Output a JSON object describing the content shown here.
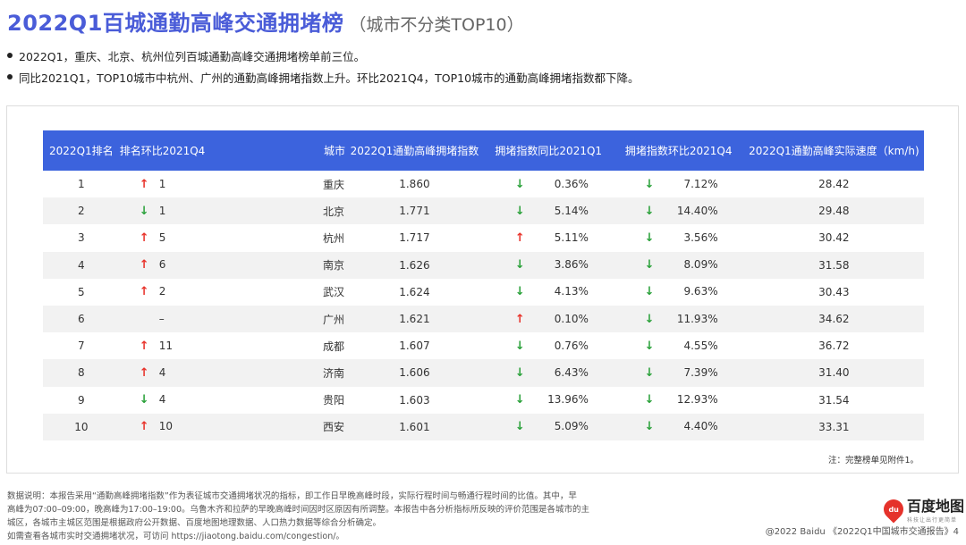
{
  "header": {
    "title": "2022Q1百城通勤高峰交通拥堵榜",
    "subtitle": "（城市不分类TOP10）"
  },
  "bullets": [
    "2022Q1，重庆、北京、杭州位列百城通勤高峰交通拥堵榜单前三位。",
    "同比2021Q1，TOP10城市中杭州、广州的通勤高峰拥堵指数上升。环比2021Q4，TOP10城市的通勤高峰拥堵指数都下降。"
  ],
  "table": {
    "columns": [
      "2022Q1排名",
      "排名环比2021Q4",
      "城市",
      "2022Q1通勤高峰拥堵指数",
      "拥堵指数同比2021Q1",
      "拥堵指数环比2021Q4",
      "2022Q1通勤高峰实际速度（km/h)"
    ],
    "rows": [
      {
        "rank": "1",
        "chg_dir": "up",
        "chg_arrow": "↑",
        "chg": "1",
        "city": "重庆",
        "index": "1.860",
        "yoy_dir": "down",
        "yoy_arrow": "↓",
        "yoy": "0.36%",
        "qoq_dir": "down",
        "qoq_arrow": "↓",
        "qoq": "7.12%",
        "speed": "28.42"
      },
      {
        "rank": "2",
        "chg_dir": "down",
        "chg_arrow": "↓",
        "chg": "1",
        "city": "北京",
        "index": "1.771",
        "yoy_dir": "down",
        "yoy_arrow": "↓",
        "yoy": "5.14%",
        "qoq_dir": "down",
        "qoq_arrow": "↓",
        "qoq": "14.40%",
        "speed": "29.48"
      },
      {
        "rank": "3",
        "chg_dir": "up",
        "chg_arrow": "↑",
        "chg": "5",
        "city": "杭州",
        "index": "1.717",
        "yoy_dir": "up",
        "yoy_arrow": "↑",
        "yoy": "5.11%",
        "qoq_dir": "down",
        "qoq_arrow": "↓",
        "qoq": "3.56%",
        "speed": "30.42"
      },
      {
        "rank": "4",
        "chg_dir": "up",
        "chg_arrow": "↑",
        "chg": "6",
        "city": "南京",
        "index": "1.626",
        "yoy_dir": "down",
        "yoy_arrow": "↓",
        "yoy": "3.86%",
        "qoq_dir": "down",
        "qoq_arrow": "↓",
        "qoq": "8.09%",
        "speed": "31.58"
      },
      {
        "rank": "5",
        "chg_dir": "up",
        "chg_arrow": "↑",
        "chg": "2",
        "city": "武汉",
        "index": "1.624",
        "yoy_dir": "down",
        "yoy_arrow": "↓",
        "yoy": "4.13%",
        "qoq_dir": "down",
        "qoq_arrow": "↓",
        "qoq": "9.63%",
        "speed": "30.43"
      },
      {
        "rank": "6",
        "chg_dir": "none",
        "chg_arrow": "",
        "chg": "–",
        "city": "广州",
        "index": "1.621",
        "yoy_dir": "up",
        "yoy_arrow": "↑",
        "yoy": "0.10%",
        "qoq_dir": "down",
        "qoq_arrow": "↓",
        "qoq": "11.93%",
        "speed": "34.62"
      },
      {
        "rank": "7",
        "chg_dir": "up",
        "chg_arrow": "↑",
        "chg": "11",
        "city": "成都",
        "index": "1.607",
        "yoy_dir": "down",
        "yoy_arrow": "↓",
        "yoy": "0.76%",
        "qoq_dir": "down",
        "qoq_arrow": "↓",
        "qoq": "4.55%",
        "speed": "36.72"
      },
      {
        "rank": "8",
        "chg_dir": "up",
        "chg_arrow": "↑",
        "chg": "4",
        "city": "济南",
        "index": "1.606",
        "yoy_dir": "down",
        "yoy_arrow": "↓",
        "yoy": "6.43%",
        "qoq_dir": "down",
        "qoq_arrow": "↓",
        "qoq": "7.39%",
        "speed": "31.40"
      },
      {
        "rank": "9",
        "chg_dir": "down",
        "chg_arrow": "↓",
        "chg": "4",
        "city": "贵阳",
        "index": "1.603",
        "yoy_dir": "down",
        "yoy_arrow": "↓",
        "yoy": "13.96%",
        "qoq_dir": "down",
        "qoq_arrow": "↓",
        "qoq": "12.93%",
        "speed": "31.54"
      },
      {
        "rank": "10",
        "chg_dir": "up",
        "chg_arrow": "↑",
        "chg": "10",
        "city": "西安",
        "index": "1.601",
        "yoy_dir": "down",
        "yoy_arrow": "↓",
        "yoy": "5.09%",
        "qoq_dir": "down",
        "qoq_arrow": "↓",
        "qoq": "4.40%",
        "speed": "33.31"
      }
    ],
    "footnote": "注：完整榜单见附件1。"
  },
  "data_note": [
    "数据说明：本报告采用“通勤高峰拥堵指数”作为表征城市交通拥堵状况的指标，即工作日早晚高峰时段，实际行程时间与畅通行程时间的比值。其中，早",
    "高峰为07:00–09:00，晚高峰为17:00–19:00。乌鲁木齐和拉萨的早晚高峰时间因时区原因有所调整。本报告中各分析指标所反映的评价范围是各城市的主",
    "城区，各城市主城区范围是根据政府公开数据、百度地图地理数据、人口热力数据等综合分析确定。",
    "如需查看各城市实时交通拥堵状况，可访问 https://jiaotong.baidu.com/congestion/。"
  ],
  "logo": {
    "mark": "du",
    "name": "百度地图",
    "tagline": "科技让出行更简单"
  },
  "copyright": "@2022 Baidu 《2022Q1中国城市交通报告》4",
  "colors": {
    "title": "#4a5cd8",
    "header_bg": "#3c63dd",
    "up_arrow": "#e8322a",
    "down_arrow": "#2aa13a",
    "logo": "#e5322b"
  }
}
